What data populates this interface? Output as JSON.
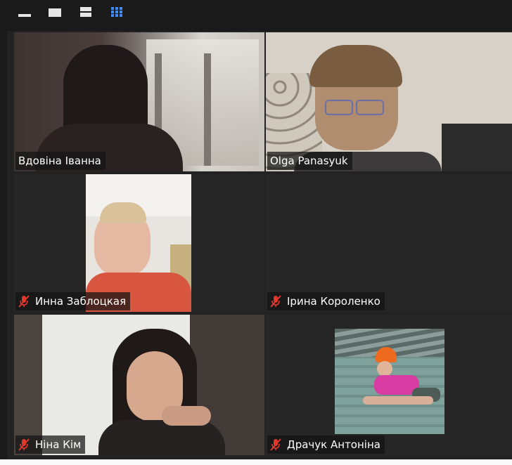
{
  "toolbar": {
    "icons": [
      "minimize-icon",
      "restore-icon",
      "speaker-view-icon",
      "gallery-view-icon"
    ]
  },
  "participants": [
    {
      "name": "Вдовіна Іванна",
      "muted": false,
      "active_speaker": true
    },
    {
      "name": "Olga Panasyuk",
      "muted": false,
      "active_speaker": false
    },
    {
      "name": "Инна Заблоцкая",
      "muted": true,
      "active_speaker": false
    },
    {
      "name": "Ірина Короленко",
      "muted": true,
      "active_speaker": false,
      "video_off": true
    },
    {
      "name": "Ніна Кім",
      "muted": true,
      "active_speaker": false
    },
    {
      "name": "Драчук Антоніна",
      "muted": true,
      "active_speaker": false
    }
  ],
  "colors": {
    "active_border": "#d7e84f",
    "muted_icon": "#e0392b",
    "background": "#1a1a1a"
  }
}
